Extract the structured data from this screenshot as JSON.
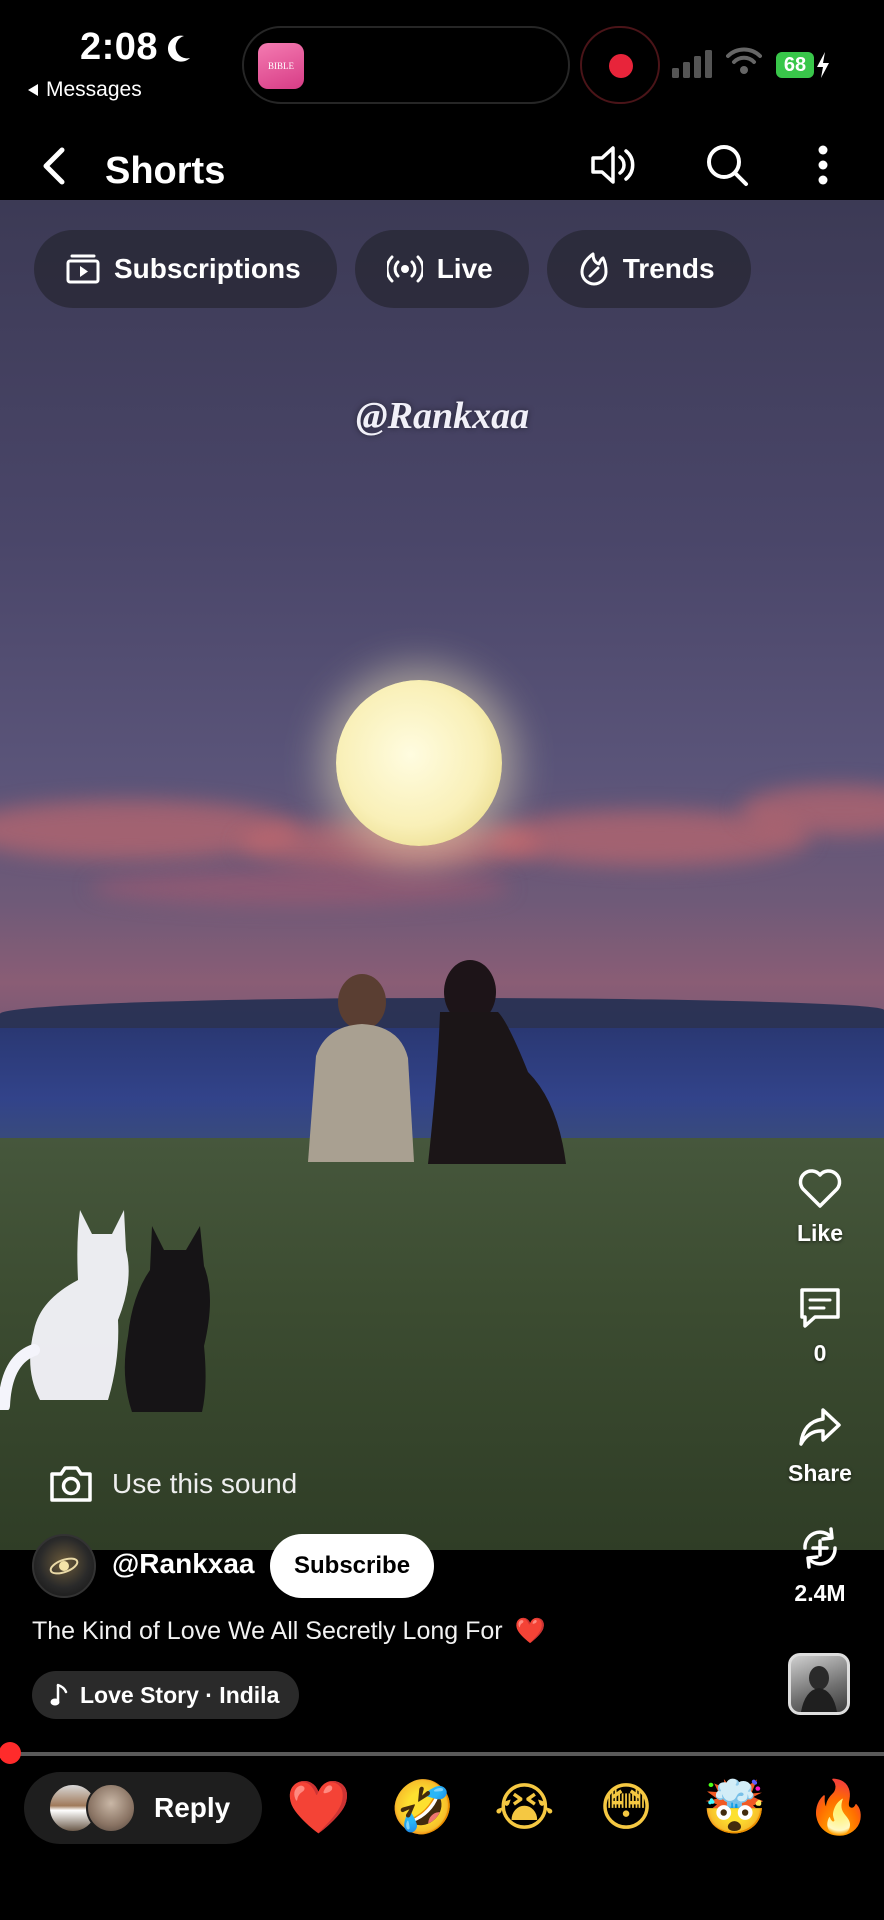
{
  "status_bar": {
    "time": "2:08",
    "back_app": "Messages",
    "battery": "68",
    "island_app_label": "BIBLE"
  },
  "header": {
    "title": "Shorts"
  },
  "chips": [
    {
      "label": "Subscriptions",
      "icon": "subscriptions-icon"
    },
    {
      "label": "Live",
      "icon": "live-icon"
    },
    {
      "label": "Trends",
      "icon": "trends-icon"
    }
  ],
  "video": {
    "watermark": "@Rankxaa",
    "use_sound_label": "Use this sound"
  },
  "actions": {
    "like_label": "Like",
    "comments_count": "0",
    "share_label": "Share",
    "remix_count": "2.4M"
  },
  "channel": {
    "name": "@Rankxaa",
    "subscribe_label": "Subscribe"
  },
  "caption": "The Kind of Love We All Secretly Long For",
  "caption_emoji": "❤️",
  "music": {
    "label": "Love Story · Indila"
  },
  "progress": {
    "percent": 1
  },
  "reply_bar": {
    "reply_label": "Reply",
    "emojis": [
      "❤️",
      "🤣",
      "😭",
      "😳",
      "🤯",
      "🔥"
    ]
  },
  "colors": {
    "accent_red": "#ff2b2b",
    "battery_green": "#39c64a",
    "record_red": "#e8243a"
  }
}
